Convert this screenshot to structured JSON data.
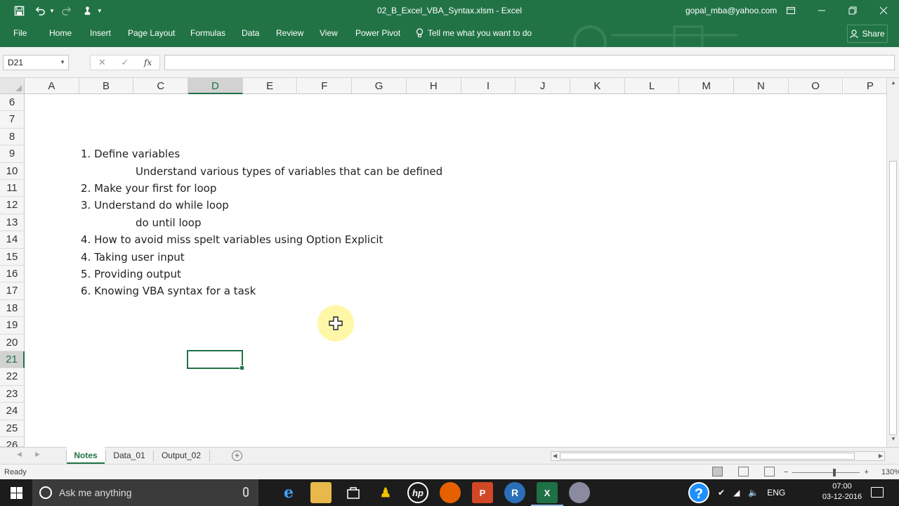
{
  "window": {
    "title": "02_B_Excel_VBA_Syntax.xlsm - Excel",
    "user": "gopal_mba@yahoo.com"
  },
  "ribbon": {
    "tabs": [
      "File",
      "Home",
      "Insert",
      "Page Layout",
      "Formulas",
      "Data",
      "Review",
      "View",
      "Power Pivot"
    ],
    "tell_me": "Tell me what you want to do",
    "share": "Share"
  },
  "formula_bar": {
    "name_box": "D21",
    "fx": "fx",
    "value": ""
  },
  "grid": {
    "columns": [
      "A",
      "B",
      "C",
      "D",
      "E",
      "F",
      "G",
      "H",
      "I",
      "J",
      "K",
      "L",
      "M",
      "N",
      "O",
      "P"
    ],
    "selected_column": "D",
    "rows": [
      "6",
      "7",
      "8",
      "9",
      "10",
      "11",
      "12",
      "13",
      "14",
      "15",
      "16",
      "17",
      "18",
      "19",
      "20",
      "21",
      "22",
      "23",
      "24",
      "25",
      "26"
    ],
    "selected_row": "21",
    "active_cell": "D21",
    "cell_texts": [
      {
        "row": "9",
        "text": "1. Define variables",
        "indent": false
      },
      {
        "row": "10",
        "text": "Understand various types of variables that can be defined",
        "indent": true
      },
      {
        "row": "11",
        "text": "2. Make your first for loop",
        "indent": false
      },
      {
        "row": "12",
        "text": "3. Understand do while loop",
        "indent": false
      },
      {
        "row": "13",
        "text": "do until loop",
        "indent": true
      },
      {
        "row": "14",
        "text": "4. How to avoid miss spelt variables using Option Explicit",
        "indent": false
      },
      {
        "row": "15",
        "text": "4. Taking user input",
        "indent": false
      },
      {
        "row": "16",
        "text": "5. Providing output",
        "indent": false
      },
      {
        "row": "17",
        "text": "6. Knowing VBA syntax for a task",
        "indent": false
      }
    ]
  },
  "sheets": {
    "tabs": [
      "Notes",
      "Data_01",
      "Output_02"
    ],
    "active": "Notes"
  },
  "status": {
    "ready": "Ready",
    "zoom": "130%"
  },
  "taskbar": {
    "search_placeholder": "Ask me anything",
    "language": "ENG",
    "time": "07:00",
    "date": "03-12-2016"
  },
  "colors": {
    "excel_green": "#217346",
    "cursor_highlight": "#fff7a8"
  }
}
